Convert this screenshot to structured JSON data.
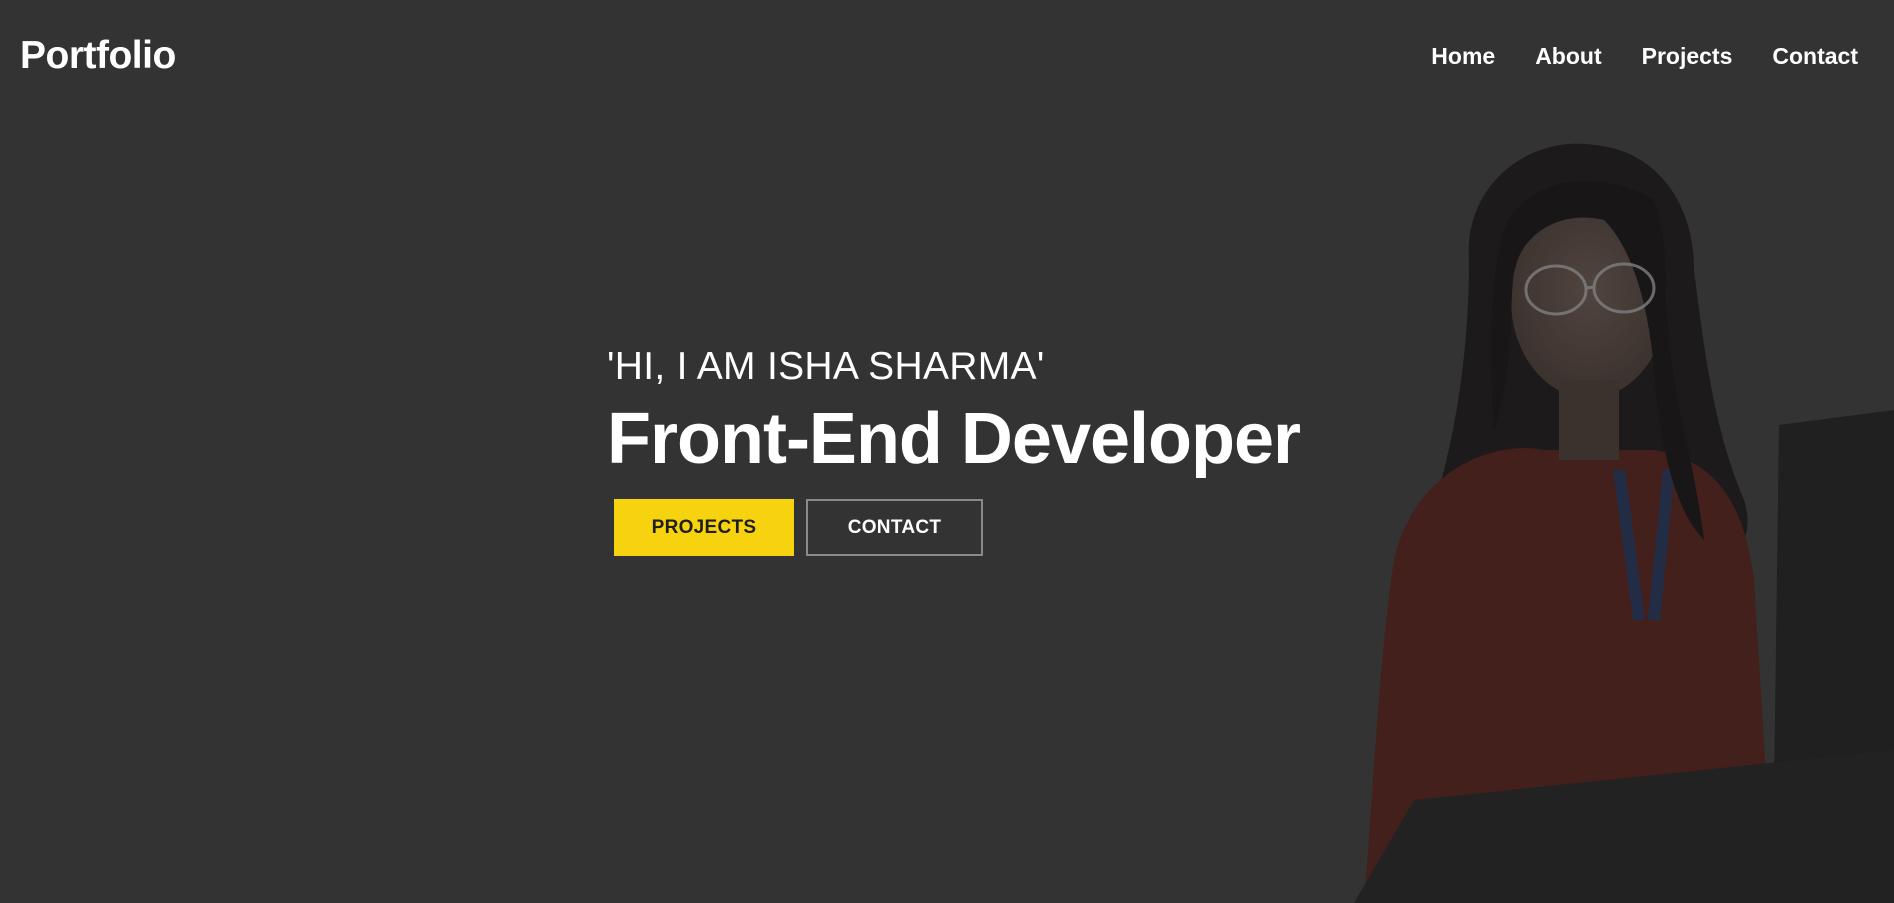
{
  "header": {
    "logo": "Portfolio",
    "nav": [
      {
        "label": "Home"
      },
      {
        "label": "About"
      },
      {
        "label": "Projects"
      },
      {
        "label": "Contact"
      }
    ]
  },
  "hero": {
    "greeting": "'HI, I AM ISHA SHARMA'",
    "title": "Front-End Developer",
    "primary_button": "PROJECTS",
    "secondary_button": "CONTACT"
  },
  "colors": {
    "background": "#333333",
    "accent": "#f7d30f",
    "text": "#ffffff"
  },
  "image": {
    "subject": "portrait-photo"
  }
}
